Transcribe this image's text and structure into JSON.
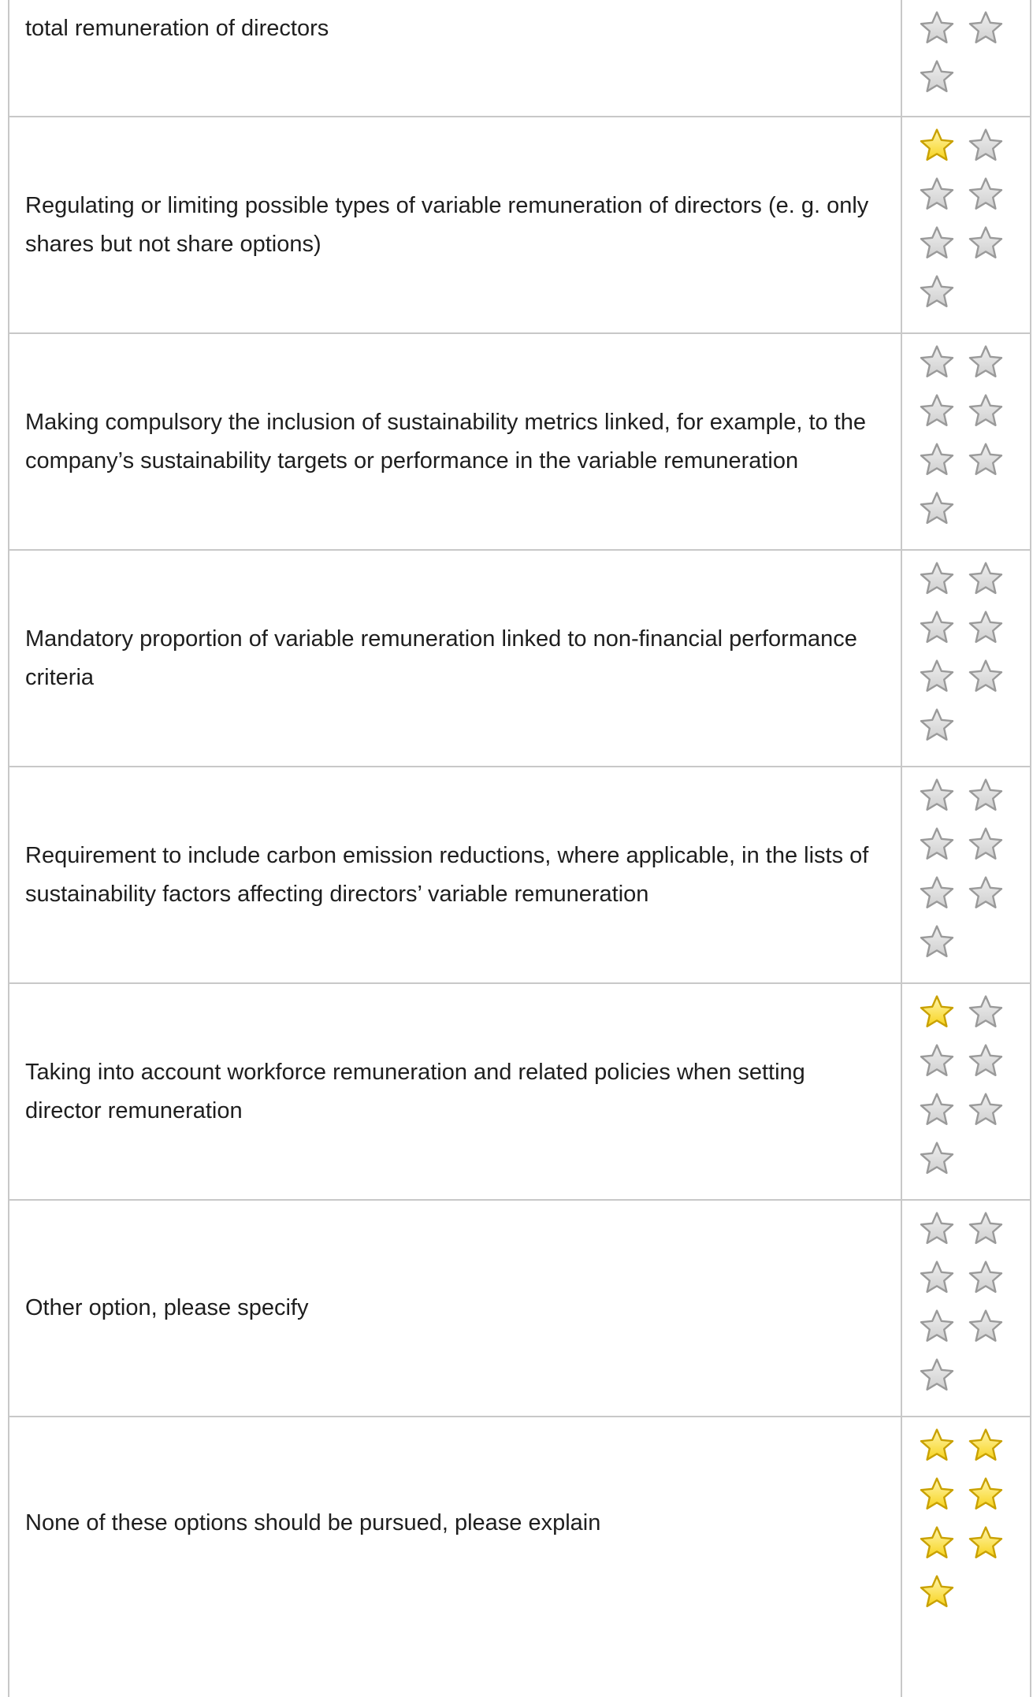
{
  "rows": [
    {
      "text": "total remuneration of directors",
      "rating": 0
    },
    {
      "text": "Regulating or limiting possible types of variable remuneration of directors (e. g. only shares but not share options)",
      "rating": 1
    },
    {
      "text": "Making compulsory the inclusion of sustainability metrics linked, for example, to the company’s sustainability targets or performance in the variable remuneration",
      "rating": 0
    },
    {
      "text": "Mandatory proportion of variable remuneration linked to non-financial performance criteria",
      "rating": 0
    },
    {
      "text": "Requirement to include carbon emission reductions, where applicable, in the lists of sustainability factors affecting directors’ variable remuneration",
      "rating": 0
    },
    {
      "text": "Taking into account workforce remuneration and related policies when setting director remuneration",
      "rating": 1
    },
    {
      "text": "Other option, please specify",
      "rating": 0
    },
    {
      "text": "None of these options should be pursued, please explain",
      "rating": 7
    }
  ],
  "first_row_visible_stars": 3,
  "stars_per_row": 7,
  "colors": {
    "star_filled": "#f7d31c",
    "star_filled_stroke": "#c9a100",
    "star_empty": "#cfcfcf",
    "star_empty_stroke": "#9a9a9a",
    "border": "#c8c8c8"
  },
  "icons": {
    "star": "star-icon"
  }
}
